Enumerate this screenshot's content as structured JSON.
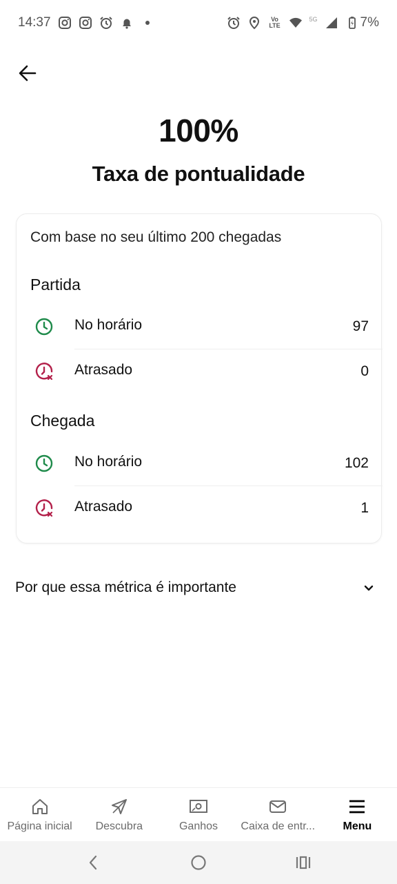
{
  "status_bar": {
    "time": "14:37",
    "battery": "7%",
    "left_icons": [
      "instagram-icon",
      "instagram-icon",
      "alarm-icon",
      "bell-icon",
      "dot-icon"
    ],
    "right_icons": [
      "alarm-icon",
      "location-icon",
      "volte-icon",
      "wifi-icon",
      "5g-icon",
      "signal-icon",
      "battery-icon"
    ],
    "volte_label_top": "Vo",
    "volte_label_bottom": "LTE",
    "net_label": "5G"
  },
  "header": {
    "score": "100%",
    "title": "Taxa de pontualidade"
  },
  "card": {
    "subtitle": "Com base no seu último 200 chegadas",
    "sections": [
      {
        "title": "Partida",
        "rows": [
          {
            "label": "No horário",
            "value": "97",
            "icon": "clock-on-time-icon"
          },
          {
            "label": "Atrasado",
            "value": "0",
            "icon": "clock-late-icon"
          }
        ]
      },
      {
        "title": "Chegada",
        "rows": [
          {
            "label": "No horário",
            "value": "102",
            "icon": "clock-on-time-icon"
          },
          {
            "label": "Atrasado",
            "value": "1",
            "icon": "clock-late-icon"
          }
        ]
      }
    ]
  },
  "info": {
    "label": "Por que essa métrica é importante"
  },
  "bottom_nav": {
    "items": [
      {
        "label": "Página inicial",
        "icon": "home-icon"
      },
      {
        "label": "Descubra",
        "icon": "compass-icon"
      },
      {
        "label": "Ganhos",
        "icon": "money-icon"
      },
      {
        "label": "Caixa de entr...",
        "icon": "mail-icon"
      },
      {
        "label": "Menu",
        "icon": "menu-icon",
        "active": true
      }
    ]
  },
  "colors": {
    "on_time": "#1e8a4a",
    "late": "#b3204a",
    "text": "#111111",
    "muted": "#6b6b6b"
  }
}
